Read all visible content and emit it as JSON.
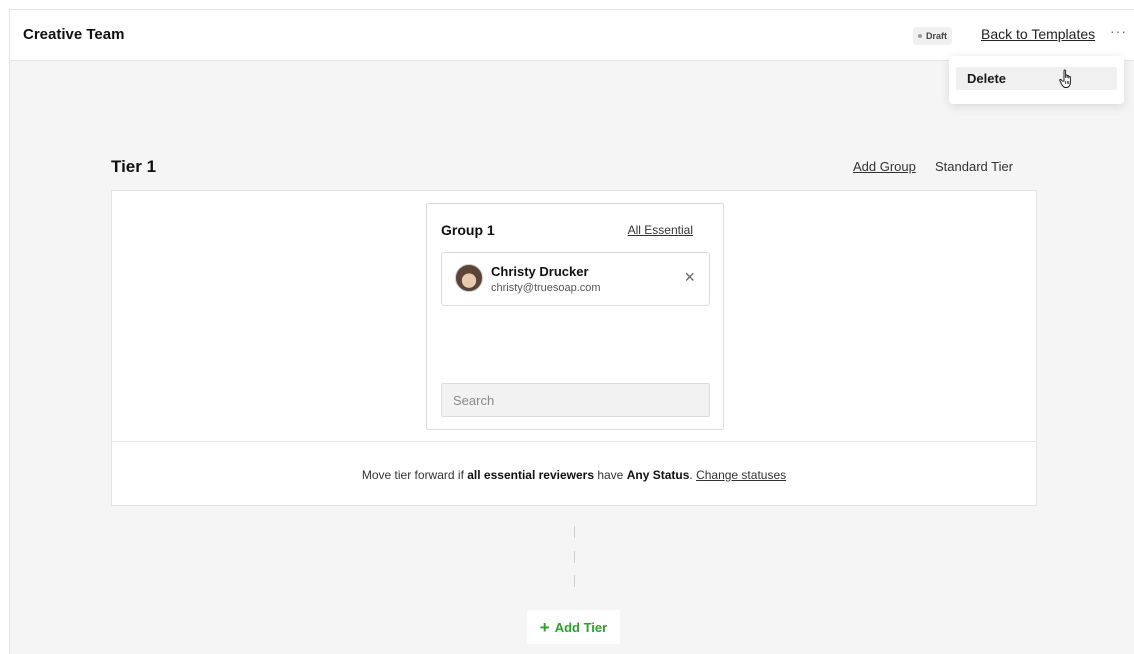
{
  "header": {
    "title": "Creative Team",
    "status_badge": "Draft",
    "back_link": "Back to Templates",
    "more_label": "···"
  },
  "menu": {
    "items": [
      {
        "label": "Delete"
      }
    ]
  },
  "tier": {
    "title": "Tier 1",
    "add_group_label": "Add Group",
    "type_label": "Standard Tier",
    "group": {
      "name": "Group 1",
      "essential_label": "All Essential",
      "reviewers": [
        {
          "name": "Christy Drucker",
          "email": "christy@truesoap.com"
        }
      ],
      "remove_icon": "×",
      "search_placeholder": "Search"
    },
    "rule": {
      "prefix": "Move tier forward if ",
      "emphasis_1": "all essential reviewers",
      "middle": " have ",
      "emphasis_2": "Any Status",
      "suffix": ". ",
      "link": "Change statuses"
    }
  },
  "add_tier": {
    "icon": "+",
    "label": "Add Tier"
  },
  "colors": {
    "accent_green": "#2aa32a",
    "background": "#f5f5f5"
  }
}
